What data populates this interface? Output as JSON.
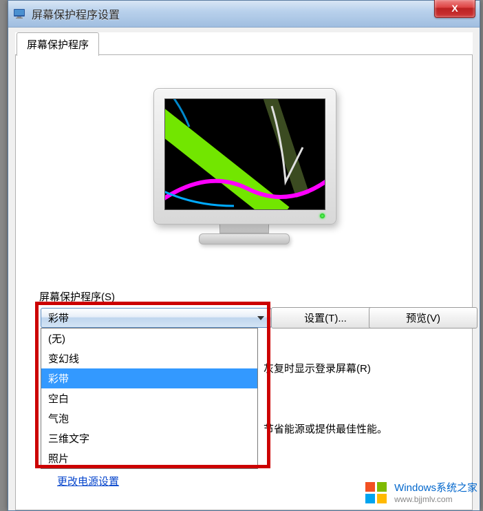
{
  "window": {
    "title": "屏幕保护程序设置",
    "close_label": "X"
  },
  "tab": {
    "label": "屏幕保护程序"
  },
  "section": {
    "label": "屏幕保护程序(S)"
  },
  "combo": {
    "selected": "彩带",
    "options": [
      "(无)",
      "变幻线",
      "彩带",
      "空白",
      "气泡",
      "三维文字",
      "照片"
    ],
    "selected_index": 2
  },
  "buttons": {
    "settings": "设置(T)...",
    "preview": "预览(V)"
  },
  "text": {
    "resume_fragment": "灰复时显示登录屏幕(R)",
    "power_fragment": "节省能源或提供最佳性能。"
  },
  "link": {
    "power_settings": "更改电源设置"
  },
  "watermark": {
    "line1": "Windows系统之家",
    "line2": "www.bjjmlv.com"
  }
}
